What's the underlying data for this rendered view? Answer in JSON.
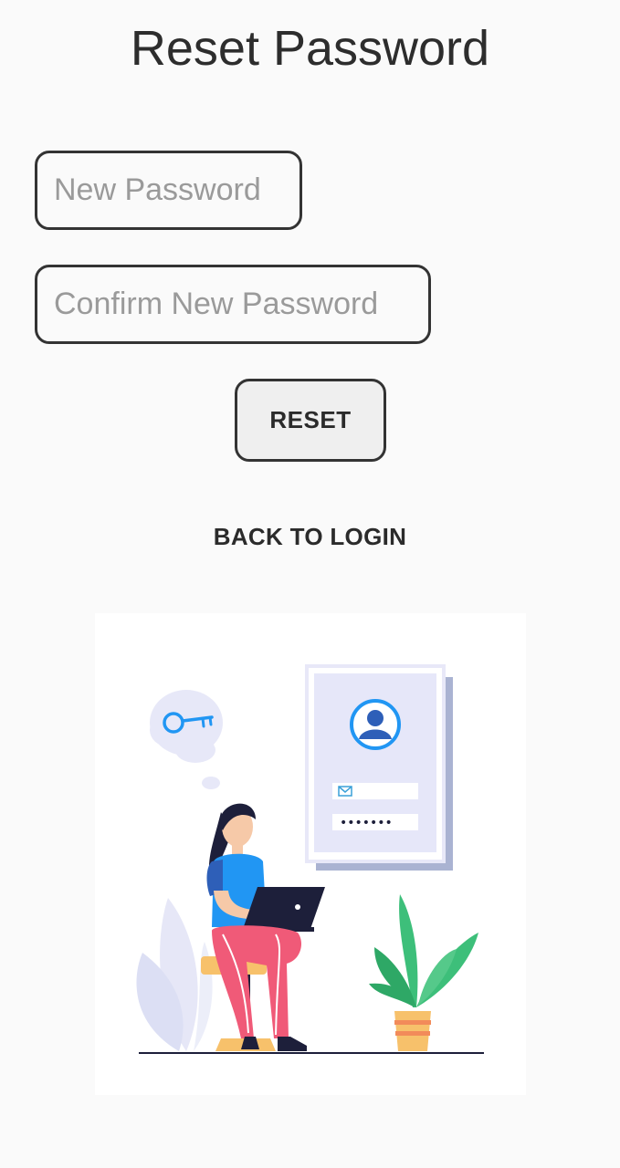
{
  "header": {
    "title": "Reset Password"
  },
  "form": {
    "new_password_placeholder": "New Password",
    "confirm_password_placeholder": "Confirm New Password",
    "reset_label": "RESET",
    "back_label": "BACK TO LOGIN"
  },
  "illustration": {
    "password_mask": "•••••••",
    "icons": [
      "key-icon",
      "user-icon",
      "mail-icon"
    ],
    "colors": {
      "accent": "#2196f3",
      "pants": "#f05a78",
      "leaf": "#3dbf7a",
      "card": "#e8e8f8"
    }
  }
}
